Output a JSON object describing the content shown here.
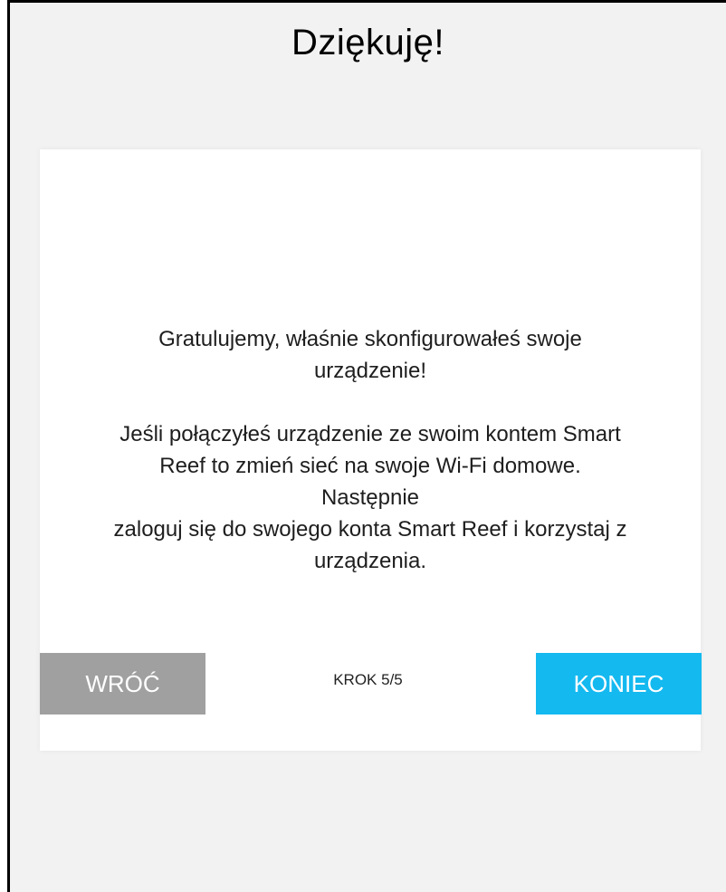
{
  "page": {
    "title": "Dziękuję!"
  },
  "card": {
    "message_1_lines": [
      "Gratulujemy, właśnie skonfigurowałeś swoje",
      "urządzenie!"
    ],
    "message_2_lines": [
      "Jeśli połączyłeś urządzenie ze swoim kontem Smart",
      "Reef to zmień sieć na swoje Wi-Fi domowe. Następnie",
      "zaloguj się do swojego konta Smart Reef i korzystaj z",
      "urządzenia."
    ]
  },
  "footer": {
    "back_label": "WRÓĆ",
    "step_label": "KROK 5/5",
    "finish_label": "KONIEC"
  },
  "colors": {
    "background": "#f2f2f2",
    "card": "#ffffff",
    "back_button": "#a0a0a0",
    "finish_button": "#14b9f0"
  }
}
